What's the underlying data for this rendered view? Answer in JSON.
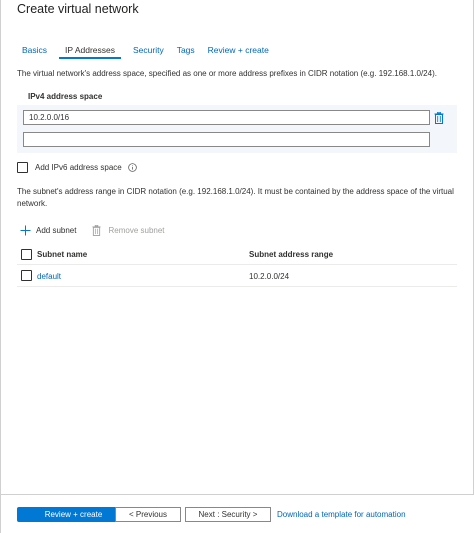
{
  "page": {
    "title": "Create virtual network"
  },
  "tabs": [
    {
      "label": "Basics",
      "active": false
    },
    {
      "label": "IP Addresses",
      "active": true
    },
    {
      "label": "Security",
      "active": false
    },
    {
      "label": "Tags",
      "active": false
    },
    {
      "label": "Review + create",
      "active": false
    }
  ],
  "address_space": {
    "description": "The virtual network's address space, specified as one or more address prefixes in CIDR notation (e.g. 192.168.1.0/24).",
    "ipv4_label": "IPv4 address space",
    "prefixes": [
      "10.2.0.0/16"
    ],
    "new_prefix_value": "",
    "delete_icon": "trash-icon"
  },
  "ipv6": {
    "label": "Add IPv6 address space",
    "checked": false,
    "info_icon": "info-icon"
  },
  "subnets": {
    "description": "The subnet's address range in CIDR notation (e.g. 192.168.1.0/24). It must be contained by the address space of the virtual network.",
    "add_label": "Add subnet",
    "remove_label": "Remove subnet",
    "columns": {
      "name": "Subnet name",
      "range": "Subnet address range"
    },
    "rows": [
      {
        "name": "default",
        "range": "10.2.0.0/24"
      }
    ]
  },
  "footer": {
    "review_create": "Review + create",
    "previous": "< Previous",
    "next": "Next : Security >",
    "download_template": "Download a template for automation"
  },
  "colors": {
    "accent": "#0078d4",
    "link": "#0067b8",
    "text": "#323130",
    "disabled": "#a19f9d"
  }
}
